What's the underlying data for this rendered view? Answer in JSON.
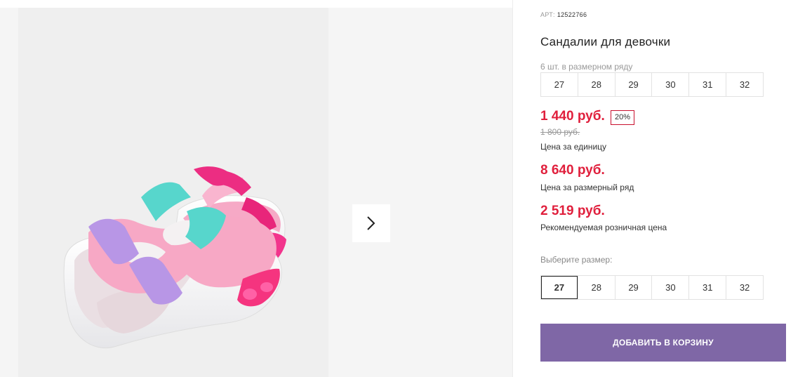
{
  "product": {
    "sku_label": "АРТ:",
    "sku_value": "12522766",
    "title": "Сандалии для девочки",
    "pack_note": "6 шт. в размерном ряду",
    "pack_sizes": [
      "27",
      "28",
      "29",
      "30",
      "31",
      "32"
    ]
  },
  "pricing": {
    "unit_price": "1 440 руб.",
    "discount": "20%",
    "old_price": "1 800 руб.",
    "unit_caption": "Цена за единицу",
    "pack_price": "8 640 руб.",
    "pack_caption": "Цена за размерный ряд",
    "retail_price": "2 519 руб.",
    "retail_caption": "Рекомендуемая розничная цена"
  },
  "size_selector": {
    "label": "Выберите размер:",
    "sizes": [
      "27",
      "28",
      "29",
      "30",
      "31",
      "32"
    ],
    "selected": "27"
  },
  "cart": {
    "button_label": "ДОБАВИТЬ В КОРЗИНУ"
  },
  "icons": {
    "next": "chevron-right-icon"
  },
  "colors": {
    "price": "#e01f3c",
    "discount_border": "#c8102e",
    "cart_button": "#7f67a6"
  }
}
